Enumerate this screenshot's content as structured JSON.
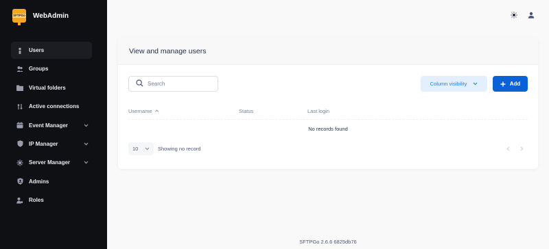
{
  "brand": {
    "logo_text": "SFTPGo",
    "title": "WebAdmin"
  },
  "sidebar": {
    "items": [
      {
        "label": "Users",
        "icon": "user-icon",
        "active": true,
        "has_submenu": false
      },
      {
        "label": "Groups",
        "icon": "groups-icon",
        "active": false,
        "has_submenu": false
      },
      {
        "label": "Virtual folders",
        "icon": "folder-icon",
        "active": false,
        "has_submenu": false
      },
      {
        "label": "Active connections",
        "icon": "connections-icon",
        "active": false,
        "has_submenu": false
      },
      {
        "label": "Event Manager",
        "icon": "calendar-icon",
        "active": false,
        "has_submenu": true
      },
      {
        "label": "IP Manager",
        "icon": "shield-icon",
        "active": false,
        "has_submenu": true
      },
      {
        "label": "Server Manager",
        "icon": "server-icon",
        "active": false,
        "has_submenu": true
      },
      {
        "label": "Admins",
        "icon": "admin-shield-icon",
        "active": false,
        "has_submenu": false
      },
      {
        "label": "Roles",
        "icon": "roles-icon",
        "active": false,
        "has_submenu": false
      }
    ]
  },
  "header": {
    "theme_icon": "sun-icon",
    "user_icon": "user-menu-icon"
  },
  "card": {
    "title": "View and manage users",
    "search_placeholder": "Search",
    "column_visibility_label": "Column visibility",
    "add_label": "Add",
    "columns": [
      "Username",
      "Status",
      "Last login"
    ],
    "sort_column": "Username",
    "empty_message": "No records found",
    "page_size": "10",
    "info_text": "Showing no record"
  },
  "footer": {
    "version": "SFTPGo 2.6.6 6825db76"
  },
  "colors": {
    "sidebar_bg": "#0f1014",
    "primary": "#0a62d6",
    "light_primary": "#e3effc",
    "logo": "#f4a623"
  }
}
